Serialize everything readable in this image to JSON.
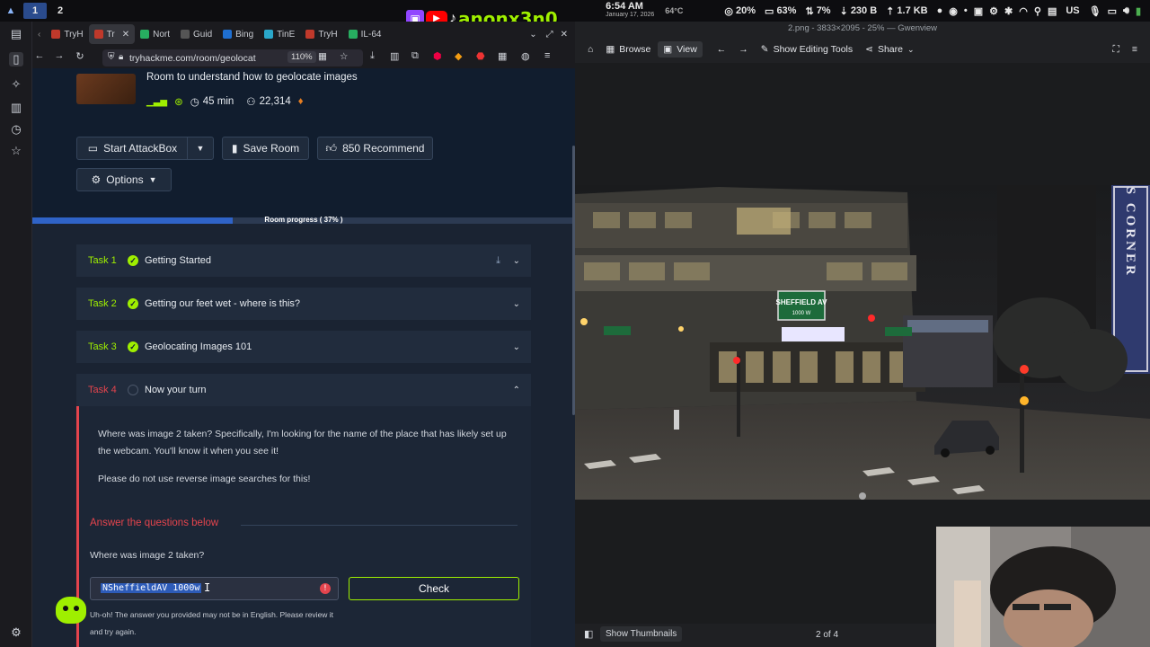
{
  "system_bar": {
    "workspaces": [
      "1",
      "2"
    ],
    "time": "6:54 AM",
    "date": "January 17, 2026",
    "temp": "64°C",
    "cpu": "20%",
    "mem": "63%",
    "load": "7%",
    "net_down": "230 B",
    "net_up": "1.7 KB",
    "layout": "US"
  },
  "stream_overlay": {
    "handle": "anonx3n0"
  },
  "browser": {
    "tabs": [
      "TryH",
      "Tr",
      "Nort",
      "Guid",
      "Bing",
      "TinE",
      "TryH",
      "IL-64"
    ],
    "url": "tryhackme.com/room/geolocat",
    "zoom": "110%"
  },
  "room": {
    "subtitle": "Room to understand how to geolocate images",
    "duration": "45 min",
    "users": "22,314",
    "buttons": {
      "start_attackbox": "Start AttackBox",
      "save_room": "Save Room",
      "recommend": "850 Recommend",
      "options": "Options"
    },
    "progress_label": "Room progress ( 37% )",
    "progress_pct": 37
  },
  "tasks": [
    {
      "num": "Task 1",
      "title": "Getting Started"
    },
    {
      "num": "Task 2",
      "title": "Getting our feet wet - where is this?"
    },
    {
      "num": "Task 3",
      "title": "Geolocating Images 101"
    },
    {
      "num": "Task 4",
      "title": "Now your turn"
    }
  ],
  "task4": {
    "para1": "Where was image 2 taken? Specifically, I'm looking for the name of the place that has likely set up the webcam. You'll know it when you see it!",
    "para2": "Please do not use reverse image searches for this!",
    "answer_header": "Answer the questions below",
    "question": "Where was image 2 taken?",
    "answer_value": "NSheffieldAV 1000w",
    "check_label": "Check",
    "error": "Uh-oh! The answer you provided may not be in English. Please review it and try again."
  },
  "viewer": {
    "title": "2.png - 3833×2095 - 25% — Gwenview",
    "toolbar": {
      "browse": "Browse",
      "view": "View",
      "show_editing_tools": "Show Editing Tools",
      "share": "Share"
    },
    "sign_text": "SPORTS CORNER",
    "street_sign": "SHEFFIELD AV",
    "street_sign_num": "1000 W",
    "show_thumbnails": "Show Thumbnails",
    "position": "2 of 4"
  },
  "colors": {
    "thm_green": "#9fef00",
    "thm_red": "#e4444d",
    "progress_blue": "#2f63c7"
  }
}
